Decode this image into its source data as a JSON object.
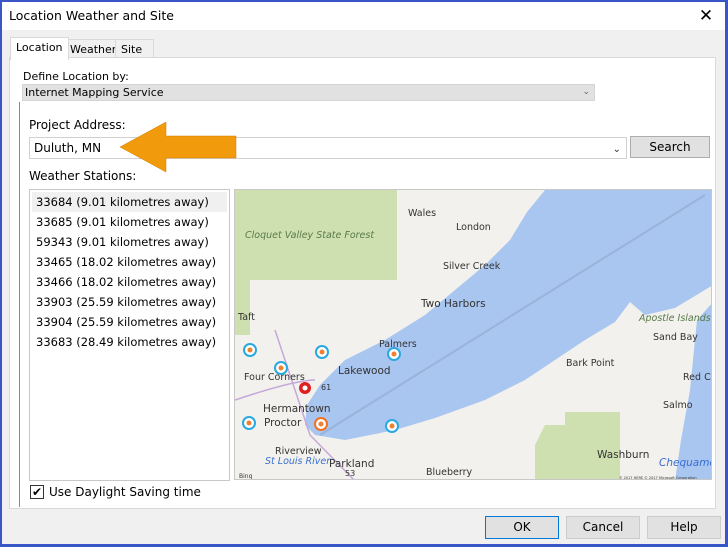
{
  "window": {
    "title": "Location Weather and Site",
    "close_icon": "close-icon"
  },
  "tabs": [
    {
      "label": "Location"
    },
    {
      "label": "Weather"
    },
    {
      "label": "Site"
    }
  ],
  "define_location": {
    "label": "Define Location by:",
    "value": "Internet Mapping Service"
  },
  "project_address": {
    "label": "Project Address:",
    "value": "Duluth, MN",
    "search_label": "Search"
  },
  "weather_stations": {
    "label": "Weather Stations:",
    "items": [
      "33684 (9.01 kilometres away)",
      "33685 (9.01 kilometres away)",
      "59343 (9.01 kilometres away)",
      "33465 (18.02 kilometres away)",
      "33466 (18.02 kilometres away)",
      "33903 (25.59 kilometres away)",
      "33904 (25.59 kilometres away)",
      "33683 (28.49 kilometres away)"
    ]
  },
  "map": {
    "labels": {
      "wales": "Wales",
      "london": "London",
      "cloquet": "Cloquet Valley State Forest",
      "silver_creek": "Silver Creek",
      "two_harbors": "Two Harbors",
      "taft": "Taft",
      "palmers": "Palmers",
      "lakewood": "Lakewood",
      "four_corners": "Four Corners",
      "hermantown": "Hermantown",
      "proctor": "Proctor",
      "riverview": "Riverview",
      "st_louis": "St Louis River",
      "parkland": "Parkland",
      "blueberry": "Blueberry",
      "apostle": "Apostle Islands",
      "sand_bay": "Sand Bay",
      "bark_point": "Bark Point",
      "red_cliff": "Red Cl",
      "salmo": "Salmo",
      "washburn": "Washburn",
      "chequamegon": "Chequame Bay",
      "hwy61": "61",
      "hwy53": "53",
      "bing": "Bing",
      "copyright": "© 2017 HERE © 2017 Microsoft Corporation"
    },
    "colors": {
      "land": "#f2f1ed",
      "water": "#a9c6f0",
      "forest": "#cfe0b0"
    }
  },
  "daylight_saving": {
    "label": "Use Daylight Saving time",
    "checked": true
  },
  "buttons": {
    "ok": "OK",
    "cancel": "Cancel",
    "help": "Help"
  },
  "accent": "#f09a0c"
}
